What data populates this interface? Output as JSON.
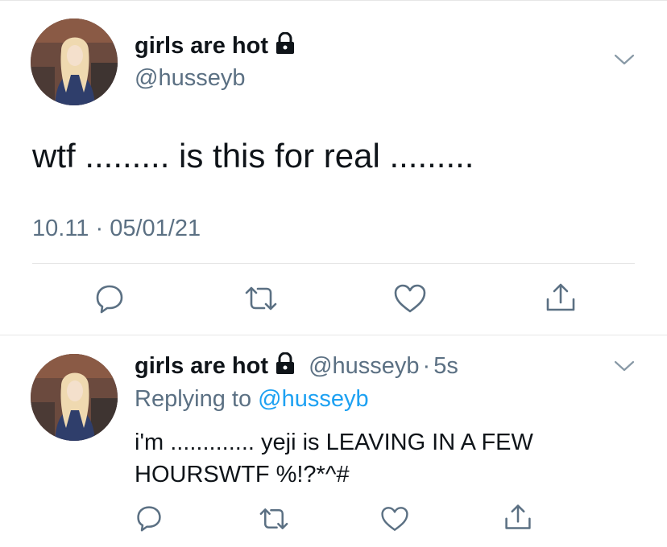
{
  "main_tweet": {
    "display_name": "girls are hot",
    "handle": "@husseyb",
    "text": "wtf ......... is this for real .........",
    "timestamp": "10.11 · 05/01/21",
    "icons": [
      "lock-icon",
      "chevron-down-icon",
      "reply-icon",
      "retweet-icon",
      "like-icon",
      "share-icon"
    ]
  },
  "reply_tweet": {
    "display_name": "girls are hot",
    "handle": "@husseyb",
    "separator": "·",
    "time": "5s",
    "replying_prefix": "Replying to",
    "replying_handle": "@husseyb",
    "text": "i'm ............. yeji is LEAVING IN A FEW HOURSWTF %!?*^#"
  },
  "colors": {
    "text": "#0f1419",
    "muted": "#5b7083",
    "link": "#1da1f2",
    "divider": "#e6e6e6"
  }
}
